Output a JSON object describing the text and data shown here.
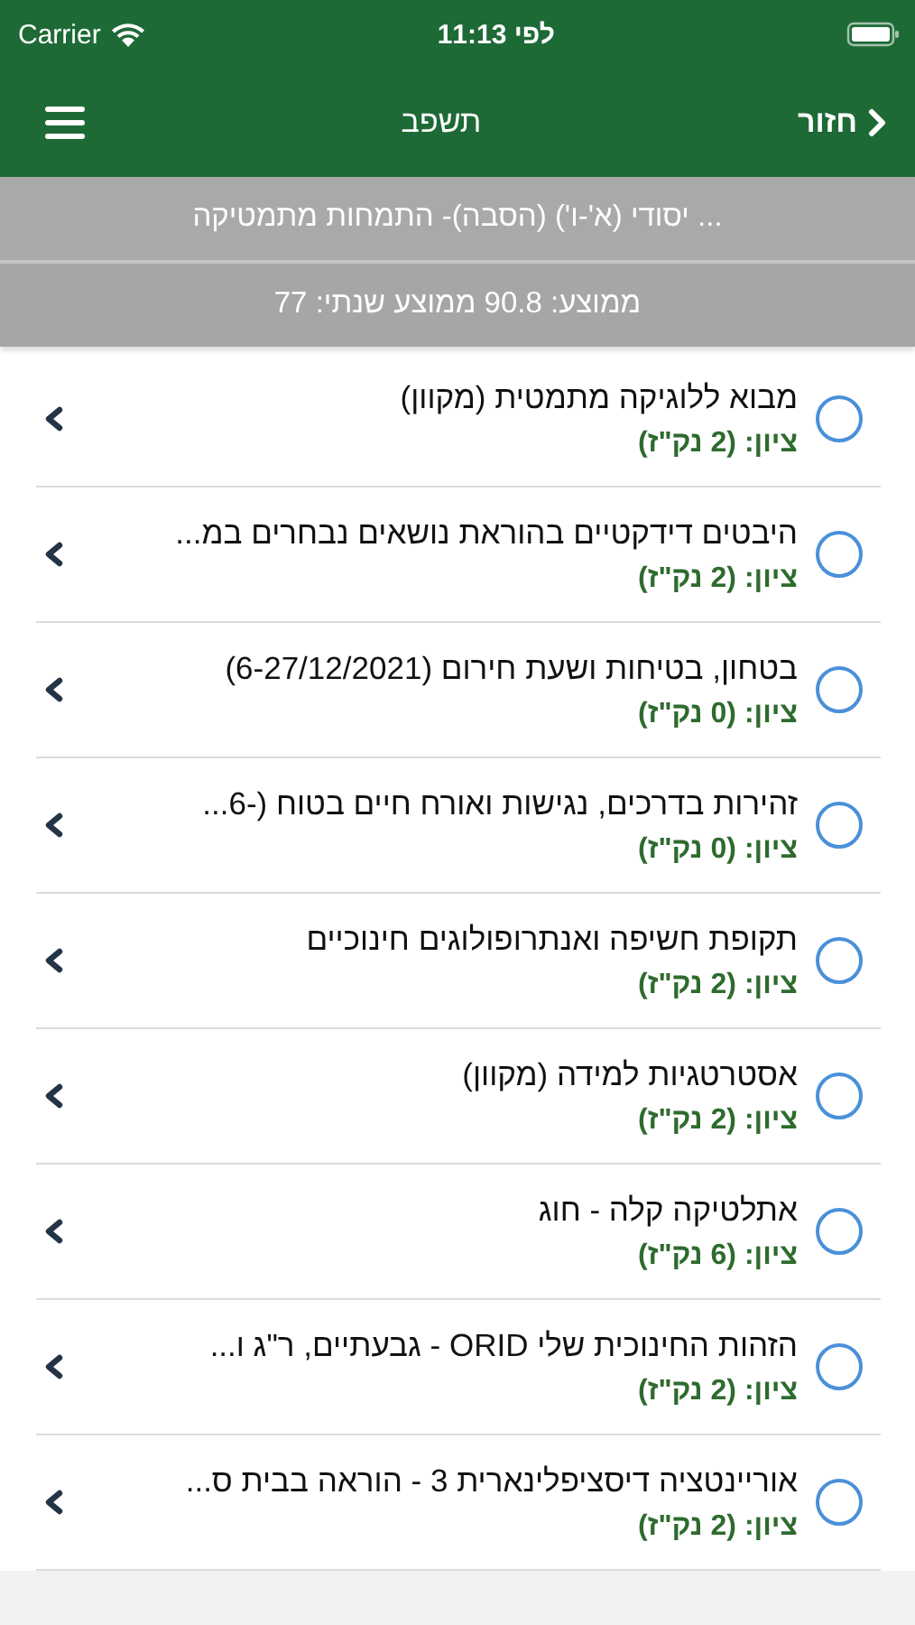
{
  "status_bar": {
    "carrier": "Carrier",
    "time": "11:13 לפי"
  },
  "nav_bar": {
    "back": "חזור",
    "title": "תשפב"
  },
  "course_header": "... יסודי (א'-ו') (הסבה)- התמחות מתמטיקה",
  "averages": "ממוצע: 90.8 ממוצע שנתי: 77",
  "courses": [
    {
      "title": "מבוא ללוגיקה מתמטית (מקוון)",
      "grade": "ציון: (2 נק\"ז)",
      "selected": false
    },
    {
      "title": "היבטים דידקטיים בהוראת נושאים נבחרים במ...",
      "grade": "ציון: (2 נק\"ז)",
      "selected": false
    },
    {
      "title": "בטחון, בטיחות ושעת חירום (6-27/12/2021)",
      "grade": "ציון: (0 נק\"ז)",
      "selected": false
    },
    {
      "title": "זהירות בדרכים, נגישות ואורח חיים בטוח (-6...",
      "grade": "ציון: (0 נק\"ז)",
      "selected": false
    },
    {
      "title": "תקופת חשיפה ואנתרופולוגים חינוכיים",
      "grade": "ציון: (2 נק\"ז)",
      "selected": false
    },
    {
      "title": "אסטרטגיות למידה (מקוון)",
      "grade": "ציון: (2 נק\"ז)",
      "selected": false
    },
    {
      "title": "אתלטיקה קלה - חוג",
      "grade": "ציון: (6 נק\"ז)",
      "selected": false
    },
    {
      "title": "הזהות החינוכית שלי ORID - גבעתיים, ר\"ג ו...",
      "grade": "ציון: (2 נק\"ז)",
      "selected": false
    },
    {
      "title": "אוריינטציה דיסציפלינארית 3 - הוראה בבית ס...",
      "grade": "ציון: (2 נק\"ז)",
      "selected": false
    }
  ]
}
